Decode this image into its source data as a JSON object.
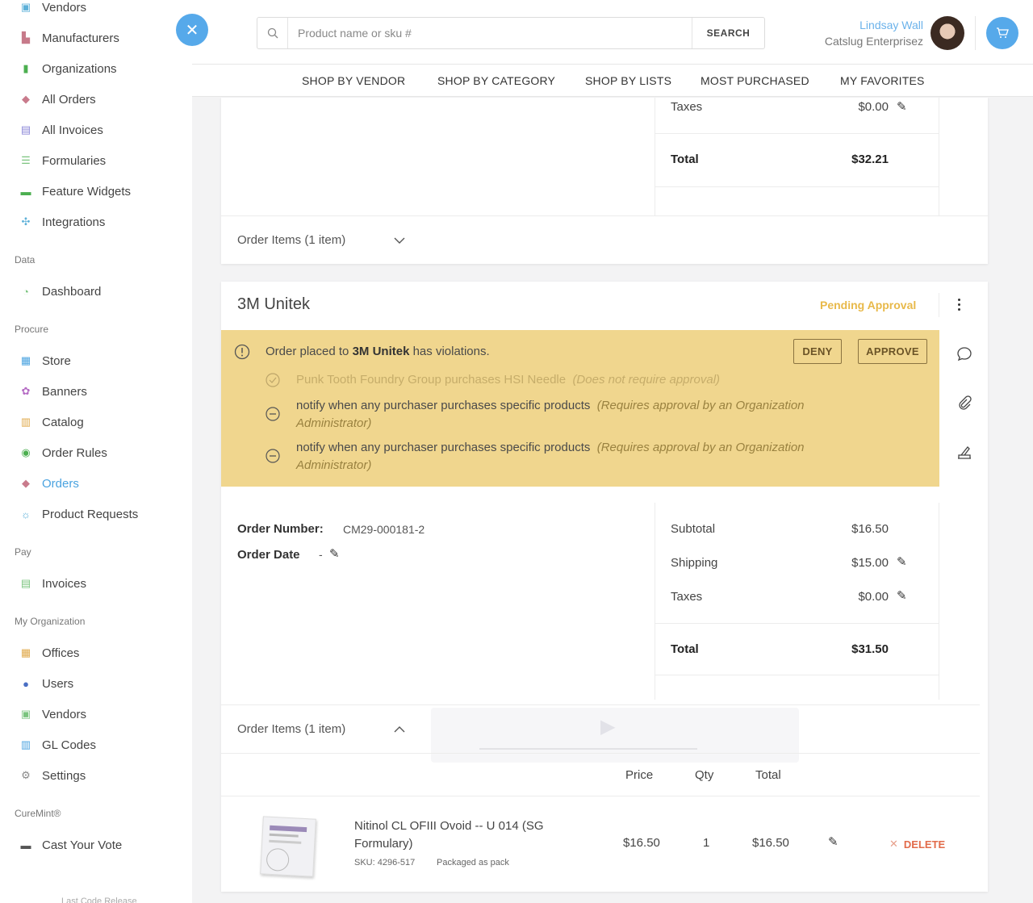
{
  "sidebar": {
    "items_top": [
      {
        "label": "Vendors",
        "icon": "vendor-icon",
        "color": "#5cb0d8"
      },
      {
        "label": "Manufacturers",
        "icon": "factory-icon",
        "color": "#c77a8a"
      },
      {
        "label": "Organizations",
        "icon": "bookmark-icon",
        "color": "#4caf50"
      },
      {
        "label": "All Orders",
        "icon": "tag-icon",
        "color": "#c97b8c"
      },
      {
        "label": "All Invoices",
        "icon": "invoice-icon",
        "color": "#8b87d8"
      },
      {
        "label": "Formularies",
        "icon": "formulary-icon",
        "color": "#7bc47f"
      },
      {
        "label": "Feature Widgets",
        "icon": "chat-icon",
        "color": "#4caf50"
      },
      {
        "label": "Integrations",
        "icon": "integration-icon",
        "color": "#5cb0d8"
      }
    ],
    "section_data": "Data",
    "items_data": [
      {
        "label": "Dashboard",
        "icon": "gauge-icon",
        "color": "#7bc47f"
      }
    ],
    "section_procure": "Procure",
    "items_procure": [
      {
        "label": "Store",
        "icon": "store-icon",
        "color": "#4aa3e0"
      },
      {
        "label": "Banners",
        "icon": "flower-icon",
        "color": "#b56bc4"
      },
      {
        "label": "Catalog",
        "icon": "book-icon",
        "color": "#e0a94a"
      },
      {
        "label": "Order Rules",
        "icon": "rules-icon",
        "color": "#4caf50"
      },
      {
        "label": "Orders",
        "icon": "tag-icon",
        "color": "#c97b8c"
      },
      {
        "label": "Product Requests",
        "icon": "lightbulb-icon",
        "color": "#5cb0d8"
      }
    ],
    "section_pay": "Pay",
    "items_pay": [
      {
        "label": "Invoices",
        "icon": "invoice-icon",
        "color": "#7bc47f"
      }
    ],
    "section_org": "My Organization",
    "items_org": [
      {
        "label": "Offices",
        "icon": "building-icon",
        "color": "#e0a94a"
      },
      {
        "label": "Users",
        "icon": "users-icon",
        "color": "#4a6fc4"
      },
      {
        "label": "Vendors",
        "icon": "vendor-icon",
        "color": "#7bc47f"
      },
      {
        "label": "GL Codes",
        "icon": "book-icon",
        "color": "#4aa3e0"
      },
      {
        "label": "Settings",
        "icon": "gear-icon",
        "color": "#888888"
      }
    ],
    "section_curemint": "CureMint®",
    "items_curemint": [
      {
        "label": "Cast Your Vote",
        "icon": "chat-icon",
        "color": "#555555"
      }
    ],
    "footer": "Last Code Release"
  },
  "header": {
    "search_placeholder": "Product name or sku #",
    "search_button": "SEARCH",
    "user_name": "Lindsay Wall",
    "user_company": "Catslug Enterprisez"
  },
  "nav": [
    "SHOP BY VENDOR",
    "SHOP BY CATEGORY",
    "SHOP BY LISTS",
    "MOST PURCHASED",
    "MY FAVORITES"
  ],
  "card1": {
    "taxes_label": "Taxes",
    "taxes_value": "$0.00",
    "total_label": "Total",
    "total_value": "$32.21",
    "order_items_label": "Order Items (1 item)"
  },
  "card2": {
    "vendor": "3M Unitek",
    "status": "Pending Approval",
    "status_color": "#e8b94a",
    "violation": {
      "message_prefix": "Order placed to ",
      "message_vendor": "3M Unitek",
      "message_suffix": " has violations.",
      "deny": "DENY",
      "approve": "APPROVE",
      "rules": [
        {
          "text": "Punk Tooth Foundry Group purchases HSI Needle",
          "note": "(Does not require approval)",
          "muted": true
        },
        {
          "text": "notify when any purchaser purchases specific products",
          "note": "(Requires approval by an Organization Administrator)",
          "muted": false
        },
        {
          "text": "notify when any purchaser purchases specific products",
          "note": "(Requires approval by an Organization Administrator)",
          "muted": false
        }
      ]
    },
    "order_number_label": "Order Number:",
    "order_number": "CM29-000181-2",
    "order_date_label": "Order Date",
    "order_date": "-",
    "subtotal_label": "Subtotal",
    "subtotal_value": "$16.50",
    "shipping_label": "Shipping",
    "shipping_value": "$15.00",
    "taxes_label": "Taxes",
    "taxes_value": "$0.00",
    "total_label": "Total",
    "total_value": "$31.50",
    "order_items_label": "Order Items (1 item)",
    "columns": [
      "Price",
      "Qty",
      "Total"
    ],
    "item": {
      "name": "Nitinol CL OFIII Ovoid -- U 014 (SG Formulary)",
      "sku": "SKU: 4296-517",
      "packaging": "Packaged as pack",
      "price": "$16.50",
      "qty": "1",
      "total": "$16.50",
      "delete": "DELETE"
    }
  }
}
